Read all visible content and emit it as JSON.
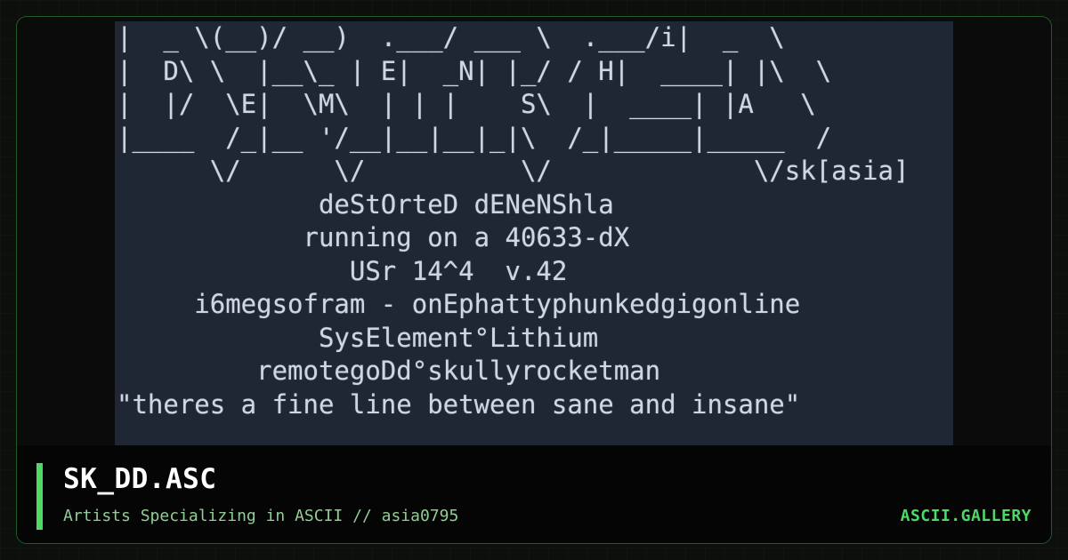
{
  "art": {
    "lines": [
      "|  _ \\(__)/ __)  .___/ ___ \\  .___/i|  _  \\",
      "|  D\\ \\  |__\\_ | E|  _N| |_/ / H|  ____| |\\  \\",
      "|  |/  \\E|  \\M\\  | | |    S\\  |  ____| |A   \\",
      "|____  /_|__ '/__|__|__|_|\\  /_|_____|_____  /",
      "      \\/      \\/          \\/             \\/sk[asia]",
      "             deStOrteD dENeNShla",
      "            running on a 40633-dX",
      "               USr 14^4  v.42",
      "     i6megsofram - onEphattyphunkedgigonline",
      "             SysElement°Lithium",
      "         remotegoDd°skullyrocketman",
      "\"theres a fine line between sane and insane\""
    ]
  },
  "footer": {
    "title": "SK_DD.ASC",
    "subtitle": "Artists Specializing in ASCII // asia0795",
    "brand": "ASCII.GALLERY"
  },
  "colors": {
    "accent": "#4cd964",
    "subtitle": "#8fce94",
    "art_background": "#202734",
    "art_text": "#cfd6e2",
    "card_border": "#1f5a2a"
  }
}
